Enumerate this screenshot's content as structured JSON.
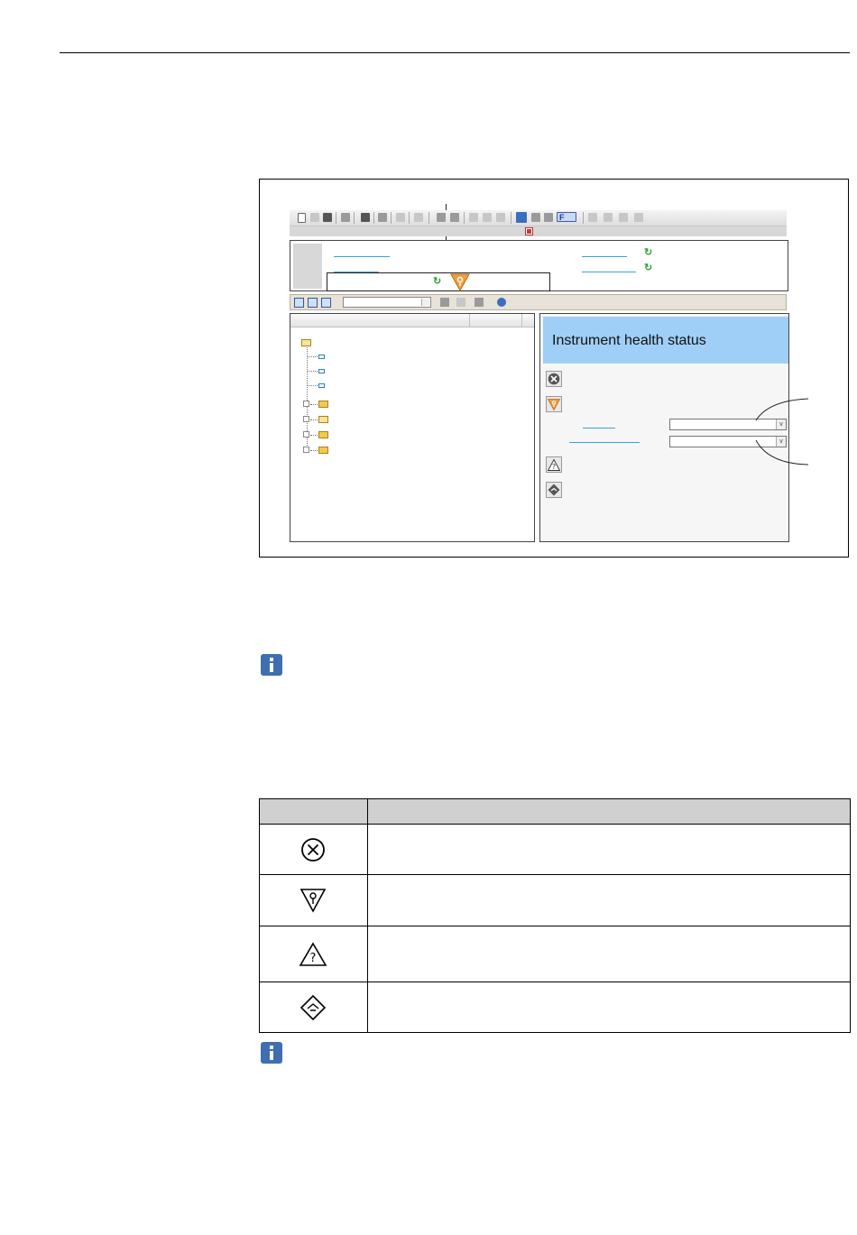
{
  "figure": {
    "status_panel_title": "Instrument health status",
    "toolbar_function_button": "F"
  },
  "table": {
    "header": [
      "",
      ""
    ],
    "rows": [
      {
        "symbol": "failure-icon",
        "description": ""
      },
      {
        "symbol": "function-check-icon",
        "description": ""
      },
      {
        "symbol": "out-of-specification-icon",
        "description": ""
      },
      {
        "symbol": "maintenance-required-icon",
        "description": ""
      }
    ]
  },
  "colors": {
    "banner": "#9fcff7",
    "info_icon": "#3f6fb0",
    "function_check_orange": "#f0a040",
    "link_blue": "#3aa0e0",
    "refresh_green": "#2fa33a"
  }
}
